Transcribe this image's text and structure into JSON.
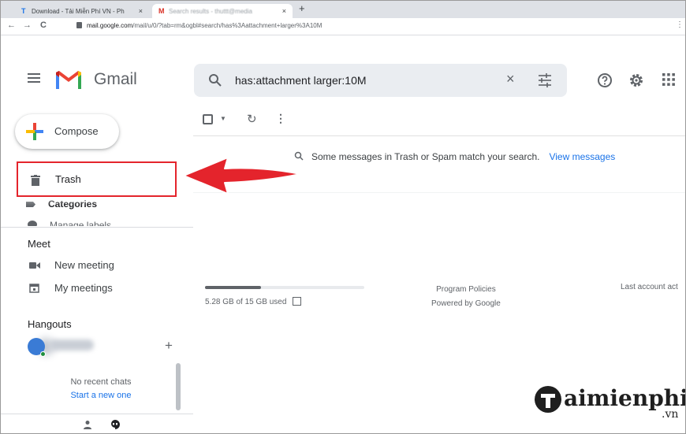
{
  "browser": {
    "tabs": [
      {
        "icon": "T",
        "title": "Download - Tải Miễn Phí VN - Ph",
        "close": "×"
      },
      {
        "icon": "M",
        "title": "Search results - thuttt@media",
        "close": "×"
      }
    ],
    "new_tab": "+",
    "nav": {
      "back": "←",
      "forward": "→",
      "reload": "C"
    },
    "url_host": "mail.google.com",
    "url_path": "/mail/u/0/?tab=rm&ogbl#search/has%3Aattachment+larger%3A10M",
    "menu": "⋮"
  },
  "gmail": {
    "logo_text": "Gmail",
    "search_query": "has:attachment larger:10M",
    "clear": "×",
    "compose_label": "Compose"
  },
  "sidebar": {
    "trash_label": "Trash",
    "categories_label": "Categories",
    "manage_labels": "Manage labels",
    "meet_heading": "Meet",
    "meet_items": [
      {
        "label": "New meeting",
        "icon": "video-icon"
      },
      {
        "label": "My meetings",
        "icon": "calendar-icon"
      }
    ],
    "hangouts_heading": "Hangouts",
    "hangouts_add": "+",
    "no_recent": "No recent chats",
    "start_new": "Start a new one"
  },
  "main": {
    "message": "Some messages in Trash or Spam match your search.",
    "message_link": "View messages",
    "storage_text": "5.28 GB of 15 GB used",
    "storage_fraction": 0.352,
    "program_policies": "Program Policies",
    "powered_by": "Powered by Google",
    "last_activity": "Last account act"
  },
  "watermark": {
    "text": "aimienphi",
    "suffix": ".vn"
  },
  "colors": {
    "highlight_red": "#e4242c",
    "link_blue": "#1a73e8"
  }
}
